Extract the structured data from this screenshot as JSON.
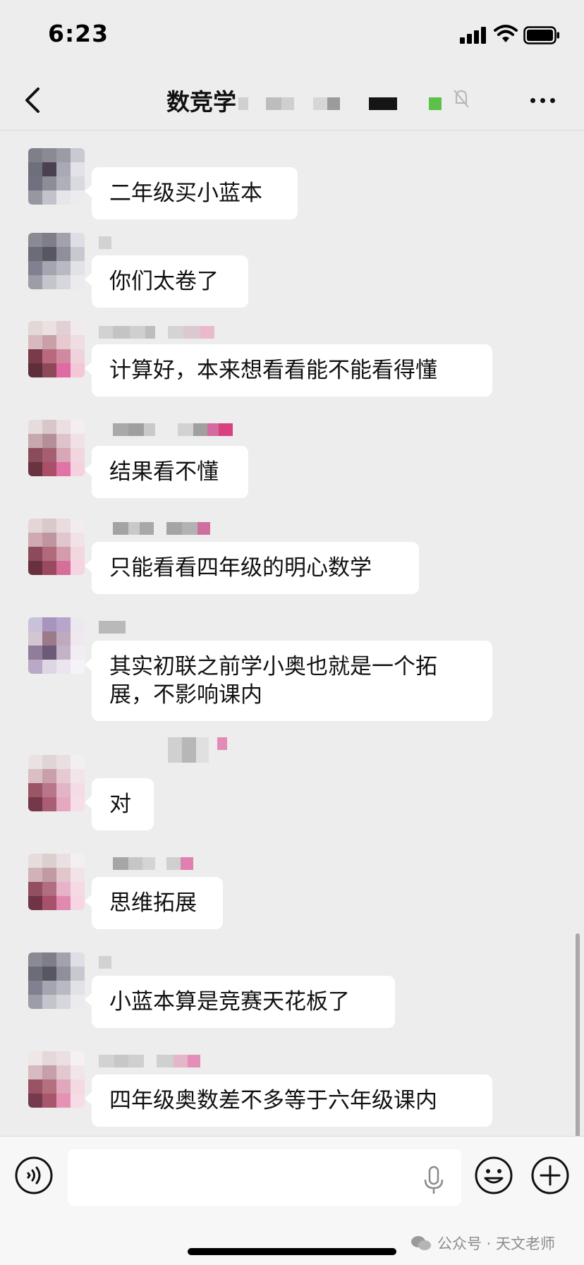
{
  "status_bar": {
    "time": "6:23"
  },
  "header": {
    "title": "数竞学"
  },
  "messages": [
    {
      "text": "二年级买小蓝本",
      "avatar_colors": [
        "#7f7f8a",
        "#8a8a95",
        "#9b9ba6",
        "#c9c9d1",
        "#6f6f7a",
        "#4a4050",
        "#a9a9b4",
        "#e2e2e8",
        "#707080",
        "#8d8d98",
        "#b0b0bb",
        "#d9d9e0",
        "#9797a2",
        "#c2c2cc",
        "#e5e5ea",
        "#ececf0"
      ]
    },
    {
      "text": "你们太卷了",
      "avatar_colors": [
        "#8a8a94",
        "#7e7e89",
        "#a2a2ad",
        "#dedee4",
        "#6c6c77",
        "#5a5563",
        "#8f8f9a",
        "#c8c8d0",
        "#808090",
        "#a5a5b0",
        "#b9b9c3",
        "#e1e1e6",
        "#9d9da8",
        "#c4c4cd",
        "#d6d6dd",
        "#ebebef"
      ]
    },
    {
      "text": "计算好，本来想看看能不能看得懂",
      "avatar_colors": [
        "#e3d8d8",
        "#ece1e1",
        "#e0cfd3",
        "#f0eaec",
        "#d9b9c0",
        "#c7a0a8",
        "#e7c9d0",
        "#eedde2",
        "#7a3b48",
        "#b86a7c",
        "#d08aa0",
        "#f1d2dc",
        "#5e2f3a",
        "#8e4858",
        "#e06aa2",
        "#f3c6d8"
      ]
    },
    {
      "text": "结果看不懂",
      "avatar_colors": [
        "#e5dcdc",
        "#d8c6c8",
        "#ecdfe2",
        "#f4eef0",
        "#c7a8ae",
        "#b58f98",
        "#dfc3ca",
        "#efe1e5",
        "#8a4c5a",
        "#a65f70",
        "#d7a7b6",
        "#f2d6df",
        "#6a3341",
        "#a94f68",
        "#e074a6",
        "#f5d0df"
      ]
    },
    {
      "text": "只能看看四年级的明心数学",
      "avatar_colors": [
        "#e4d6d6",
        "#d9c9cb",
        "#e9dcdf",
        "#f3ecee",
        "#cfaab2",
        "#be95a0",
        "#e2c6cd",
        "#f0e2e6",
        "#8c4a5a",
        "#b06a7c",
        "#d49bac",
        "#f3d7df",
        "#693140",
        "#9a4a5e",
        "#d56e98",
        "#f5d3e0"
      ]
    },
    {
      "text": "其实初联之前学小奥也就是一个拓展，不影响课内",
      "avatar_colors": [
        "#c9c1d6",
        "#a894bf",
        "#b7a5cb",
        "#ece7f1",
        "#d3c5d1",
        "#9b7b8a",
        "#bfa9bc",
        "#efe9ef",
        "#8f7d9a",
        "#6e5a78",
        "#c4b2c8",
        "#f1eef3",
        "#b9a9c6",
        "#ded6e4",
        "#eae5ee",
        "#f5f3f7"
      ]
    },
    {
      "text": "对",
      "avatar_colors": [
        "#eae2e2",
        "#e0d5d6",
        "#e9dfe1",
        "#f3eef0",
        "#d9bfc4",
        "#c99fa9",
        "#e6cad1",
        "#f1e5e9",
        "#9b5566",
        "#b9768a",
        "#e1b5c6",
        "#f4dbe5",
        "#74384a",
        "#a85f76",
        "#e6a7c1",
        "#f6dde7"
      ]
    },
    {
      "text": "思维拓展",
      "avatar_colors": [
        "#e6dcdc",
        "#dccfd0",
        "#eadfe2",
        "#f4eff1",
        "#d2b2b9",
        "#c29aa4",
        "#e3c5cc",
        "#f1e3e7",
        "#934f61",
        "#b16d82",
        "#e6b4c8",
        "#f5d9e3",
        "#6f3547",
        "#a7516b",
        "#e08ab0",
        "#f6d6e3"
      ]
    },
    {
      "text": "小蓝本算是竞赛天花板了",
      "avatar_colors": [
        "#8a8a94",
        "#7e7e89",
        "#a2a2ad",
        "#dedee4",
        "#6c6c77",
        "#5a5563",
        "#8f8f9a",
        "#c8c8d0",
        "#808090",
        "#a5a5b0",
        "#b9b9c3",
        "#e1e1e6",
        "#9d9da8",
        "#c4c4cd",
        "#d6d6dd",
        "#ebebef"
      ]
    },
    {
      "text": "四年级奥数差不多等于六年级课内",
      "avatar_colors": [
        "#efe6e6",
        "#e4d8da",
        "#ecdfe2",
        "#f5f0f2",
        "#d7bbc1",
        "#c59fa9",
        "#e4c8cf",
        "#f2e5e9",
        "#9a5265",
        "#b4707f",
        "#e0a8bc",
        "#f4d8e2",
        "#753a4b",
        "#a8566c",
        "#e592b4",
        "#f7dbe6"
      ]
    }
  ],
  "watermark": {
    "text": "公众号 · 天文老师"
  }
}
